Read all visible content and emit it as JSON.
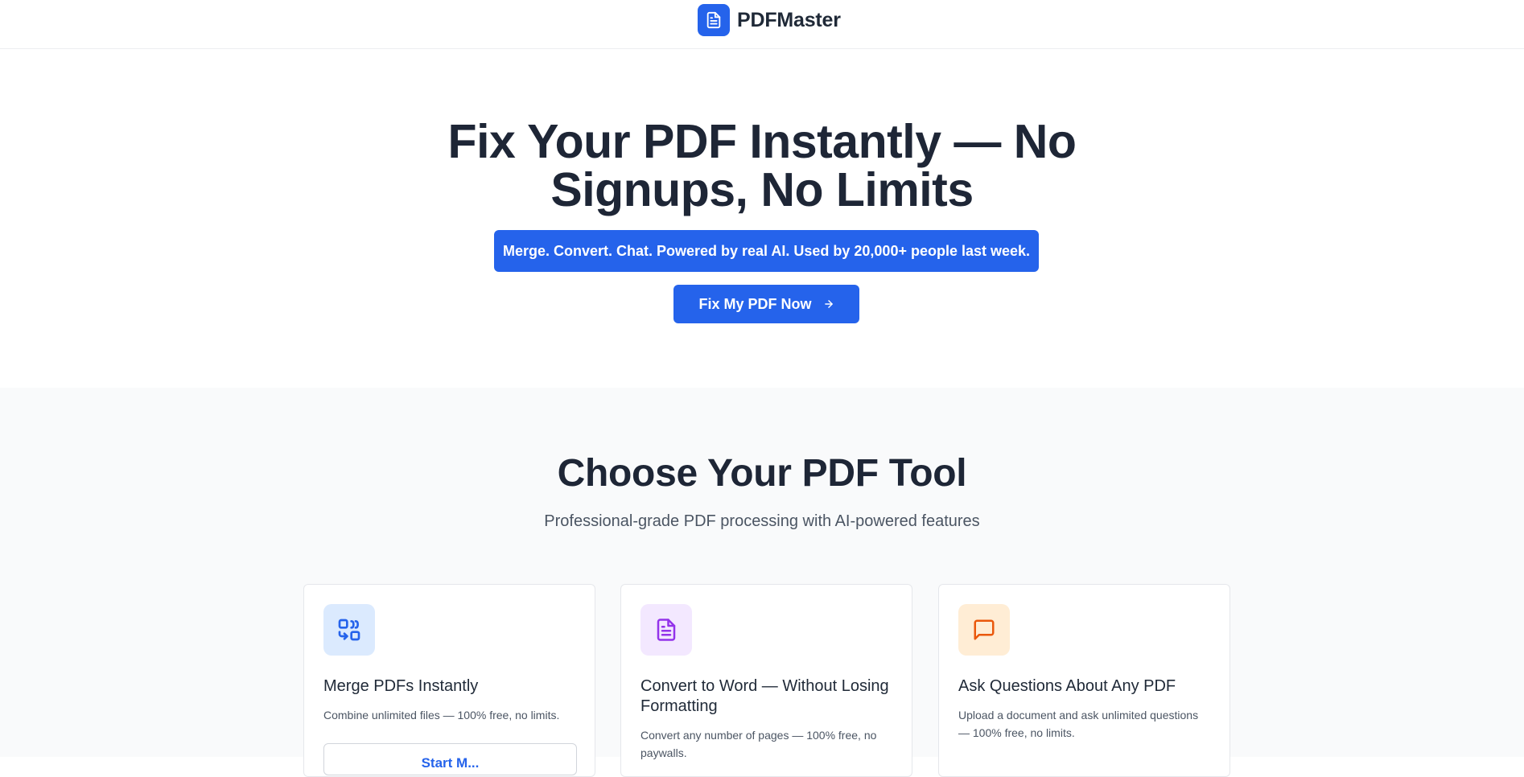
{
  "header": {
    "brand_name": "PDFMaster",
    "logo_icon": "document-icon"
  },
  "hero": {
    "title": "Fix Your PDF Instantly — No Signups, No Limits",
    "badge": "Merge. Convert. Chat. Powered by real AI. Used by 20,000+ people last week.",
    "cta_label": "Fix My PDF Now",
    "cta_icon": "arrow-right-icon"
  },
  "tools": {
    "title": "Choose Your PDF Tool",
    "subtitle": "Professional-grade PDF processing with AI-powered features",
    "cards": [
      {
        "icon": "merge-icon",
        "icon_bg": "#dbeafe",
        "icon_color": "#2563eb",
        "title": "Merge PDFs Instantly",
        "description": "Combine unlimited files — 100% free, no limits.",
        "button_label": "Start M..."
      },
      {
        "icon": "document-icon",
        "icon_bg": "#f3e8ff",
        "icon_color": "#9333ea",
        "title": "Convert to Word — Without Losing Formatting",
        "description": "Convert any number of pages — 100% free, no paywalls."
      },
      {
        "icon": "chat-icon",
        "icon_bg": "#ffedd5",
        "icon_color": "#ea580c",
        "title": "Ask Questions About Any PDF",
        "description": "Upload a document and ask unlimited questions — 100% free, no limits."
      }
    ]
  },
  "colors": {
    "primary": "#2563eb",
    "heading": "#1e2636",
    "muted_text": "#4b5563",
    "section_bg": "#f9fafb"
  }
}
